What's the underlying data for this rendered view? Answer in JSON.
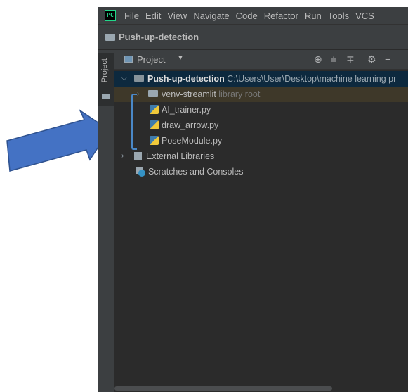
{
  "app": {
    "logo_text": "PC"
  },
  "menu": [
    {
      "mnemonic": "F",
      "rest": "ile"
    },
    {
      "mnemonic": "E",
      "rest": "dit"
    },
    {
      "mnemonic": "V",
      "rest": "iew"
    },
    {
      "mnemonic": "N",
      "rest": "avigate"
    },
    {
      "mnemonic": "C",
      "rest": "ode"
    },
    {
      "mnemonic": "R",
      "rest": "efactor"
    },
    {
      "pre": "R",
      "mnemonic": "u",
      "rest": "n"
    },
    {
      "mnemonic": "T",
      "rest": "ools"
    },
    {
      "pre": "VC",
      "mnemonic": "S",
      "rest": ""
    }
  ],
  "breadcrumb": {
    "project": "Push-up-detection"
  },
  "sidebar": {
    "project_tab": "Project"
  },
  "tool_window": {
    "title": "Project",
    "tools": [
      "locate-icon",
      "expand-all-icon",
      "collapse-all-icon",
      "gear-icon",
      "hide-icon"
    ]
  },
  "tree": {
    "root": {
      "name": "Push-up-detection",
      "path": "C:\\Users\\User\\Desktop\\machine learning pr"
    },
    "venv": {
      "name": "venv-streamlit",
      "hint": "library root"
    },
    "files": [
      "AI_trainer.py",
      "draw_arrow.py",
      "PoseModule.py"
    ],
    "external": "External Libraries",
    "scratches": "Scratches and Consoles"
  },
  "colors": {
    "arrow_fill": "#4472c4",
    "arrow_stroke": "#2f528f",
    "bracket": "#4a88c7",
    "selection": "#0d293e"
  }
}
